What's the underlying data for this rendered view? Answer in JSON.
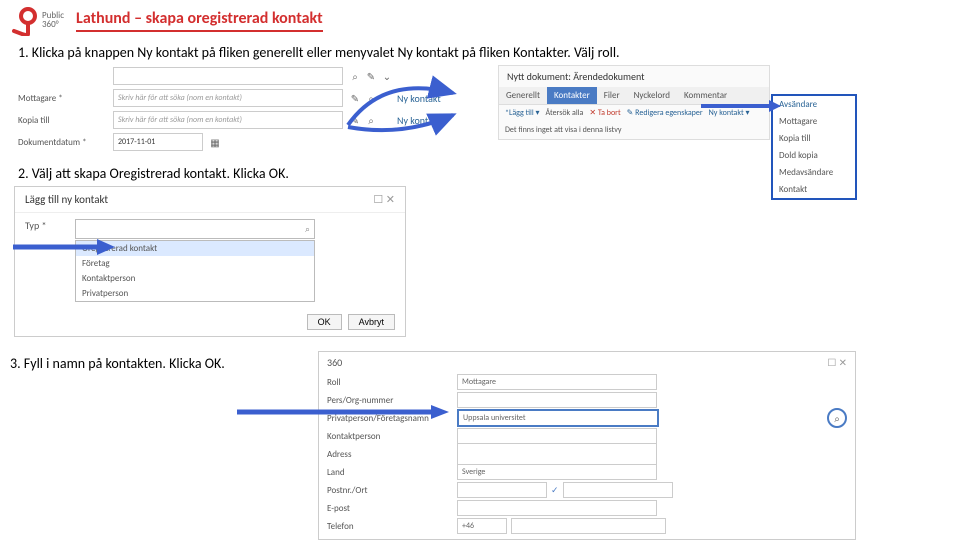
{
  "header": {
    "brand_line1": "Public",
    "brand_line2": "360°",
    "title": "Lathund – skapa oregistrerad kontakt"
  },
  "steps": {
    "s1": "1.    Klicka på knappen Ny kontakt på fliken generellt eller menyvalet Ny kontakt på fliken Kontakter. Välj roll.",
    "s2": "2. Välj att skapa Oregistrerad kontakt. Klicka OK.",
    "s3": "3. Fyll i namn på kontakten. Klicka OK."
  },
  "fig1a": {
    "lbl_mottagare": "Mottagare *",
    "lbl_kopia": "Kopia till",
    "lbl_datum": "Dokumentdatum *",
    "placeholder": "Skriv här för att söka (nom en kontakt)",
    "date": "2017-11-01",
    "link_nykontakt": "Ny kontakt"
  },
  "fig1b": {
    "wintitle": "Nytt dokument: Ärendedokument",
    "tabs": {
      "generellt": "Generellt",
      "kontakter": "Kontakter",
      "filer": "Filer",
      "nyckelord": "Nyckelord",
      "kommentar": "Kommentar"
    },
    "toolbar": {
      "lagg": "*Lägg till ▾",
      "ateroka": "Återsök alla",
      "tabort": "✕ Ta bort",
      "redigera": "✎ Redigera egenskaper",
      "nykontakt": "Ny kontakt ▾"
    },
    "body": "Det finns inget att visa i denna listvy",
    "menu": {
      "avsandare": "Avsändare",
      "mottagare": "Mottagare",
      "kopia": "Kopia till",
      "doldkopia": "Dold kopia",
      "medavsandare": "Medavsändare",
      "kontakt": "Kontakt"
    }
  },
  "fig2": {
    "dlgtitle": "Lägg till ny kontakt",
    "lbl_typ": "Typ *",
    "options": {
      "oregistrerad": "Oregistrerad kontakt",
      "foretag": "Företag",
      "kontaktperson": "Kontaktperson",
      "privatperson": "Privatperson"
    },
    "btn_ok": "OK",
    "btn_avbryt": "Avbryt"
  },
  "fig3": {
    "brand": "360",
    "lbl_roll": "Roll",
    "val_roll": "Mottagare",
    "lbl_pers": "Pers/Org-nummer",
    "lbl_namn": "Privatperson/Företagsnamn *",
    "val_namn": "Uppsala universitet",
    "lbl_kontaktperson": "Kontaktperson",
    "lbl_adress": "Adress",
    "lbl_land": "Land",
    "val_land": "Sverige",
    "lbl_postnr": "Postnr./Ort",
    "lbl_epost": "E-post",
    "lbl_telefon": "Telefon",
    "val_telefon": "+46"
  }
}
